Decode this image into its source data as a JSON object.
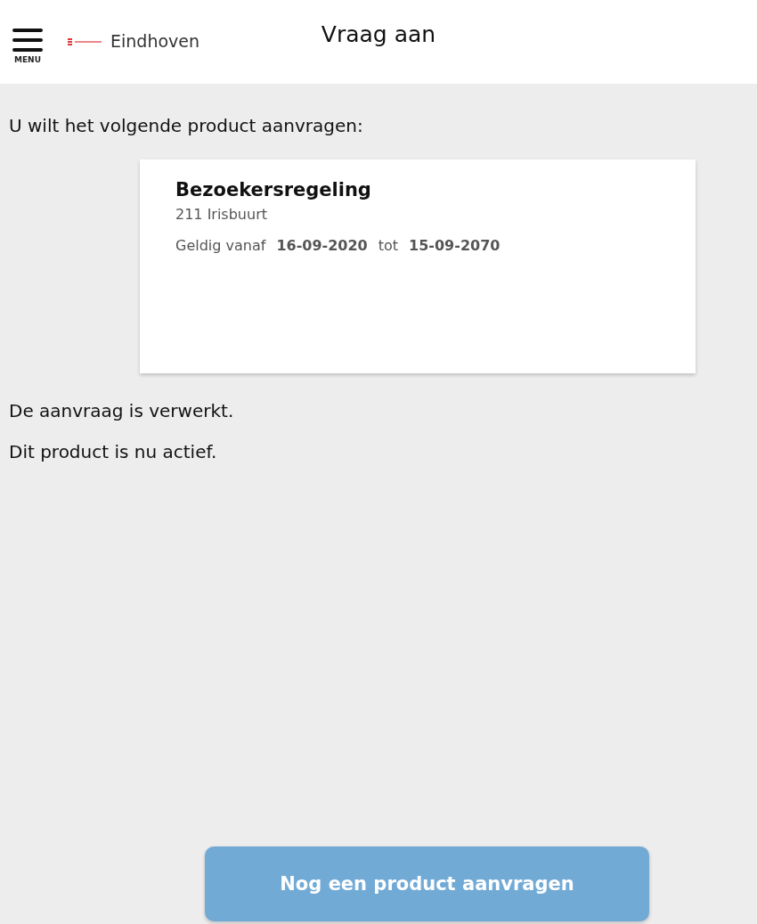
{
  "header": {
    "menu_label": "MENU",
    "city": "Eindhoven",
    "title": "Vraag aan"
  },
  "intro": "U wilt het volgende product aanvragen:",
  "product": {
    "name": "Bezoekersregeling",
    "area": "211 Irisbuurt",
    "valid_from_label": "Geldig vanaf",
    "valid_from": "16-09-2020",
    "valid_to_label": "tot",
    "valid_to": "15-09-2070"
  },
  "messages": [
    "De aanvraag is verwerkt.",
    "Dit product is nu actief."
  ],
  "button": "Nog een product aanvragen"
}
